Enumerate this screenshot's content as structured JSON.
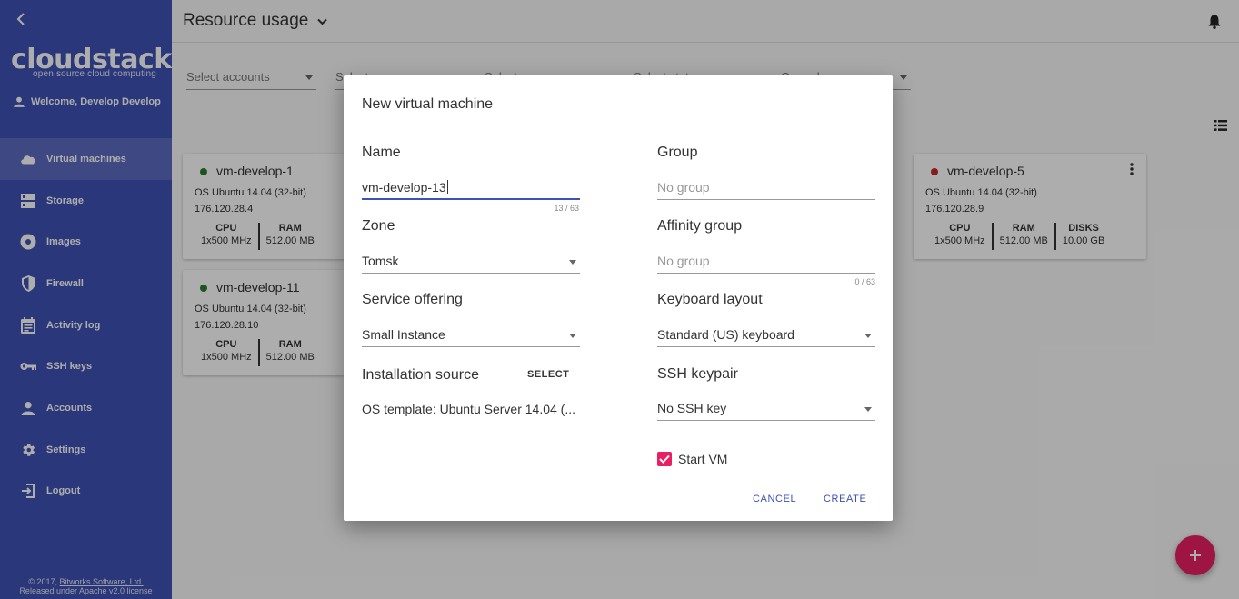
{
  "sidebar": {
    "logo_main": "cloudstack",
    "logo_sub": "open source cloud computing",
    "welcome": "Welcome, Develop Develop",
    "items": [
      {
        "label": "Virtual machines",
        "icon": "cloud-icon"
      },
      {
        "label": "Storage",
        "icon": "storage-icon"
      },
      {
        "label": "Images",
        "icon": "disc-icon"
      },
      {
        "label": "Firewall",
        "icon": "shield-icon"
      },
      {
        "label": "Activity log",
        "icon": "calendar-icon"
      },
      {
        "label": "SSH keys",
        "icon": "key-icon"
      },
      {
        "label": "Accounts",
        "icon": "person-icon"
      },
      {
        "label": "Settings",
        "icon": "gear-icon"
      },
      {
        "label": "Logout",
        "icon": "logout-icon"
      }
    ],
    "footer_line1_prefix": "© 2017, ",
    "footer_link": "Bitworks Software, Ltd.",
    "footer_line2": "Released under Apache v2.0 license"
  },
  "header": {
    "title": "Resource usage"
  },
  "filters": {
    "accounts_placeholder": "Select accounts",
    "second_placeholder": "Select",
    "third_placeholder": "Select",
    "fourth_placeholder": "Select states",
    "fifth_placeholder": "Group by"
  },
  "vms": [
    {
      "name": "vm-develop-1",
      "status": "running",
      "os": "OS Ubuntu 14.04 (32-bit)",
      "ip": "176.120.28.4",
      "cpu_label": "CPU",
      "cpu": "1x500 MHz",
      "ram_label": "RAM",
      "ram": "512.00 MB"
    },
    {
      "name": "vm-develop-11",
      "status": "running",
      "os": "OS Ubuntu 14.04 (32-bit)",
      "ip": "176.120.28.10",
      "cpu_label": "CPU",
      "cpu": "1x500 MHz",
      "ram_label": "RAM",
      "ram": "512.00 MB"
    },
    {
      "name": "vm-develop-5",
      "status": "stopped",
      "os": "OS Ubuntu 14.04 (32-bit)",
      "ip": "176.120.28.9",
      "cpu_label": "CPU",
      "cpu": "1x500 MHz",
      "ram_label": "RAM",
      "ram": "512.00 MB",
      "disks_label": "DISKS",
      "disks": "10.00 GB"
    }
  ],
  "colors": {
    "primary": "#3f51b5",
    "accent": "#e91e63",
    "running": "#2e7d32",
    "stopped": "#c62828"
  },
  "dialog": {
    "title": "New virtual machine",
    "name_label": "Name",
    "name_value": "vm-develop-13",
    "name_counter": "13 / 63",
    "group_label": "Group",
    "group_placeholder": "No group",
    "zone_label": "Zone",
    "zone_value": "Tomsk",
    "affinity_label": "Affinity group",
    "affinity_placeholder": "No group",
    "affinity_counter": "0 / 63",
    "service_label": "Service offering",
    "service_value": "Small Instance",
    "keyboard_label": "Keyboard layout",
    "keyboard_value": "Standard (US) keyboard",
    "install_label": "Installation source",
    "install_select": "SELECT",
    "install_value": "OS template: Ubuntu Server 14.04 (...",
    "ssh_label": "SSH keypair",
    "ssh_value": "No SSH key",
    "start_vm_label": "Start VM",
    "start_vm_checked": true,
    "cancel": "CANCEL",
    "create": "CREATE"
  }
}
